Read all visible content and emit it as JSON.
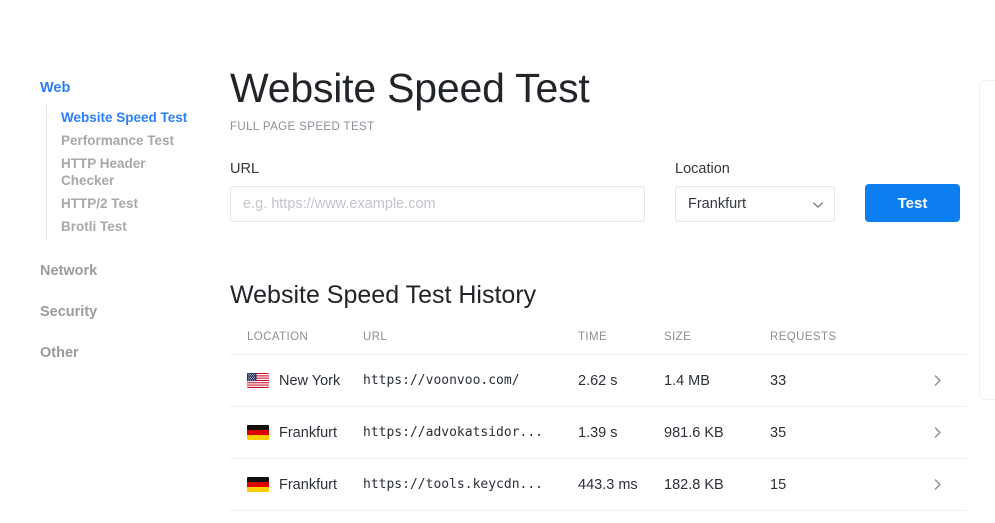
{
  "sidebar": {
    "groups": [
      {
        "label": "Web",
        "active": true,
        "items": [
          {
            "label": "Website Speed Test",
            "active": true
          },
          {
            "label": "Performance Test",
            "active": false
          },
          {
            "label": "HTTP Header Checker",
            "active": false
          },
          {
            "label": "HTTP/2 Test",
            "active": false
          },
          {
            "label": "Brotli Test",
            "active": false
          }
        ]
      },
      {
        "label": "Network",
        "active": false,
        "items": []
      },
      {
        "label": "Security",
        "active": false,
        "items": []
      },
      {
        "label": "Other",
        "active": false,
        "items": []
      }
    ]
  },
  "header": {
    "title": "Website Speed Test",
    "subtitle": "FULL PAGE SPEED TEST"
  },
  "form": {
    "url_label": "URL",
    "url_value": "",
    "url_placeholder": "e.g. https://www.example.com",
    "location_label": "Location",
    "location_value": "Frankfurt",
    "location_options": [
      "Frankfurt"
    ],
    "caret_icon": "chevron-down-icon",
    "test_label": "Test"
  },
  "history": {
    "title": "Website Speed Test History",
    "columns": [
      "LOCATION",
      "URL",
      "TIME",
      "SIZE",
      "REQUESTS"
    ],
    "rows": [
      {
        "flag": "us-flag-icon",
        "location": "New York",
        "url": "https://voonvoo.com/",
        "time": "2.62 s",
        "size": "1.4 MB",
        "requests": "33",
        "arrow": "chevron-right-icon"
      },
      {
        "flag": "de-flag-icon",
        "location": "Frankfurt",
        "url": "https://advokatsidor...",
        "time": "1.39 s",
        "size": "981.6 KB",
        "requests": "35",
        "arrow": "chevron-right-icon"
      },
      {
        "flag": "de-flag-icon",
        "location": "Frankfurt",
        "url": "https://tools.keycdn...",
        "time": "443.3 ms",
        "size": "182.8 KB",
        "requests": "15",
        "arrow": "chevron-right-icon"
      }
    ]
  },
  "colors": {
    "accent_blue": "#0d7ef0",
    "link_blue": "#2d7ff9",
    "muted_gray": "#a6a8ac",
    "text_dark": "#212529",
    "border_light": "#eceef1"
  }
}
